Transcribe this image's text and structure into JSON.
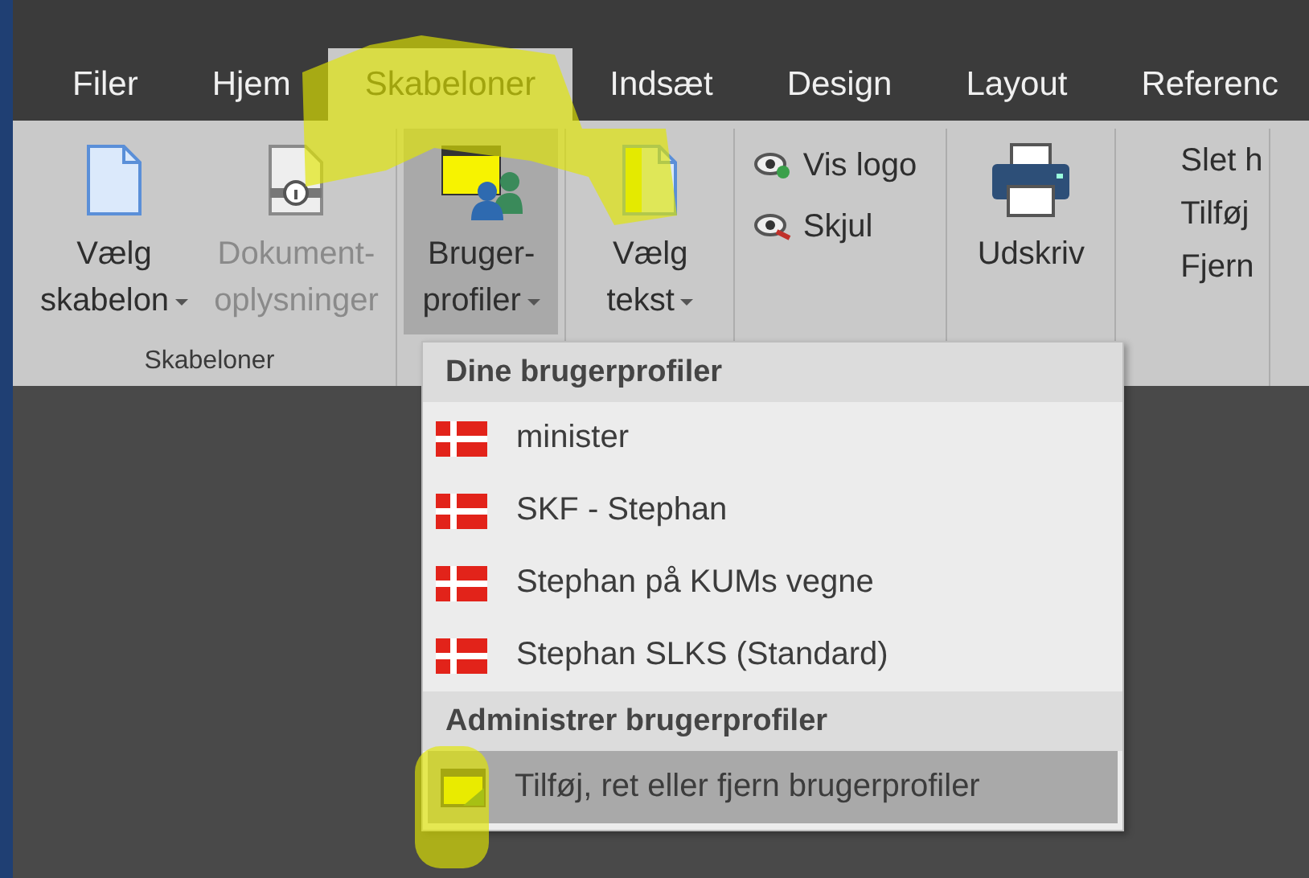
{
  "tabs": [
    {
      "label": "Filer",
      "selected": false
    },
    {
      "label": "Hjem",
      "selected": false
    },
    {
      "label": "Skabeloner",
      "selected": true
    },
    {
      "label": "Indsæt",
      "selected": false
    },
    {
      "label": "Design",
      "selected": false
    },
    {
      "label": "Layout",
      "selected": false
    },
    {
      "label": "Referenc",
      "selected": false
    }
  ],
  "ribbon": [
    {
      "label": "Skabeloner",
      "items": [
        {
          "kind": "large",
          "lines": [
            "Vælg",
            "skabelon"
          ],
          "dropdown": true,
          "disabled": false,
          "pressed": false
        },
        {
          "kind": "large",
          "lines": [
            "Dokument-",
            "oplysninger"
          ],
          "dropdown": false,
          "disabled": true,
          "pressed": false
        }
      ]
    },
    {
      "items": [
        {
          "kind": "large",
          "lines": [
            "Bruger-",
            "profiler"
          ],
          "dropdown": true,
          "disabled": false,
          "pressed": true
        }
      ]
    },
    {
      "items": [
        {
          "kind": "large",
          "lines": [
            "Vælg",
            "tekst"
          ],
          "dropdown": true,
          "disabled": false,
          "pressed": false
        }
      ]
    },
    {
      "items": [
        {
          "kind": "small",
          "label": "Vis logo"
        },
        {
          "kind": "small",
          "label": "Skjul"
        }
      ]
    },
    {
      "items": [
        {
          "kind": "large",
          "lines": [
            "Udskriv"
          ],
          "dropdown": false,
          "disabled": false,
          "pressed": false
        }
      ]
    },
    {
      "items": [
        {
          "kind": "plain",
          "label": "Slet h"
        },
        {
          "kind": "plain",
          "label": "Tilføj"
        },
        {
          "kind": "plain",
          "label": "Fjern"
        }
      ]
    }
  ],
  "menu": [
    {
      "kind": "header",
      "label": "Dine brugerprofiler"
    },
    {
      "kind": "profile",
      "label": "minister",
      "selected": false
    },
    {
      "kind": "profile",
      "label": "SKF - Stephan",
      "selected": false
    },
    {
      "kind": "profile",
      "label": "Stephan på KUMs vegne",
      "selected": false
    },
    {
      "kind": "profile",
      "label": "Stephan SLKS (Standard)",
      "selected": false
    },
    {
      "kind": "header",
      "label": "Administrer brugerprofiler"
    },
    {
      "kind": "action",
      "label": "Tilføj, ret eller fjern brugerprofiler",
      "selected": true
    }
  ]
}
